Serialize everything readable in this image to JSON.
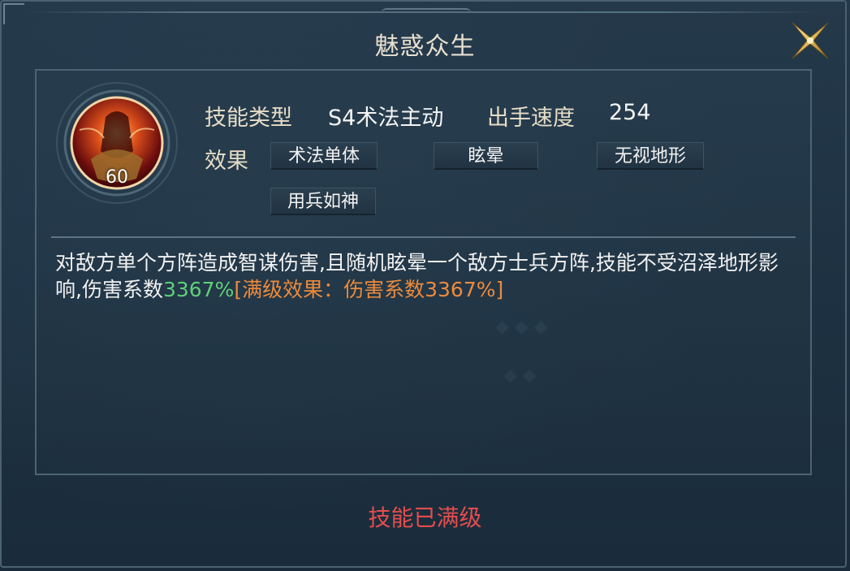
{
  "dialog": {
    "title": "魅惑众生",
    "close_icon": "close-x-icon"
  },
  "skill": {
    "icon": "skill-portrait-icon",
    "level": "60",
    "type_label": "技能类型",
    "type_value": "S4术法主动",
    "speed_label": "出手速度",
    "speed_value": "254",
    "effect_label": "效果",
    "tags": [
      "术法单体",
      "眩晕",
      "无视地形",
      "用兵如神"
    ]
  },
  "description": {
    "main": "对敌方单个方阵造成智谋伤害,且随机眩晕一个敌方士兵方阵,技能不受沼泽地形影响,伤害系数",
    "coef": "3367%",
    "maxlevel": "[满级效果：伤害系数3367%]"
  },
  "footer": {
    "status": "技能已满级"
  },
  "colors": {
    "title": "#e8e0cf",
    "coef_green": "#5fd07a",
    "maxlevel_orange": "#ee8a3b",
    "status_red": "#e54d4d"
  }
}
